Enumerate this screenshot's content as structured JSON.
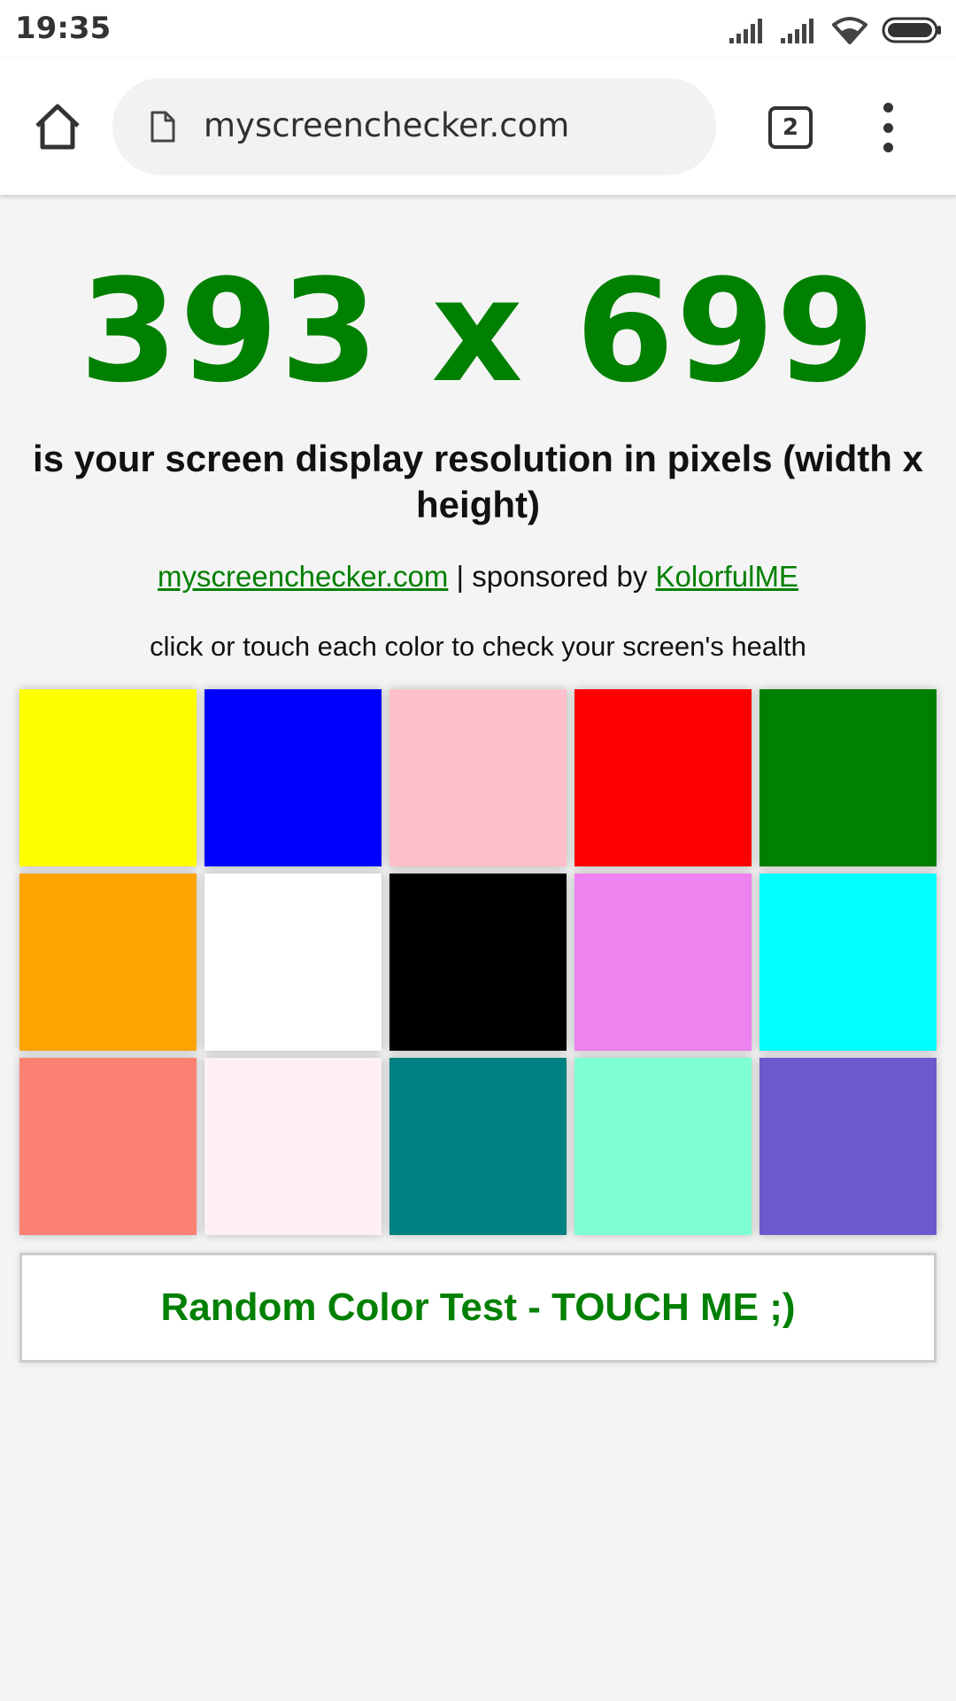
{
  "status": {
    "time": "19:35"
  },
  "browser": {
    "url": "myscreenchecker.com",
    "tab_count": "2"
  },
  "page": {
    "resolution": "393 x 699",
    "subtitle": "is your screen display resolution in pixels (width x height)",
    "site_link": "myscreenchecker.com",
    "sponsor_text": " | sponsored by ",
    "sponsor_link": "KolorfulME",
    "instruction": "click or touch each color to check your screen's health",
    "random_button": "Random Color Test - TOUCH ME ;)"
  },
  "colors": {
    "accent_green": "#008000",
    "swatches": [
      "#ffff00",
      "#0000ff",
      "#ffc0cb",
      "#ff0000",
      "#008000",
      "#ffa500",
      "#ffffff",
      "#000000",
      "#ee82ee",
      "#00ffff",
      "#fa8072",
      "#fff0f5",
      "#008080",
      "#7fffd4",
      "#6a5acd"
    ]
  },
  "icons": {
    "home": "home-icon",
    "page": "page-icon",
    "menu": "more-vert-icon",
    "signal": "signal-icon",
    "wifi": "wifi-icon",
    "battery": "battery-icon"
  }
}
